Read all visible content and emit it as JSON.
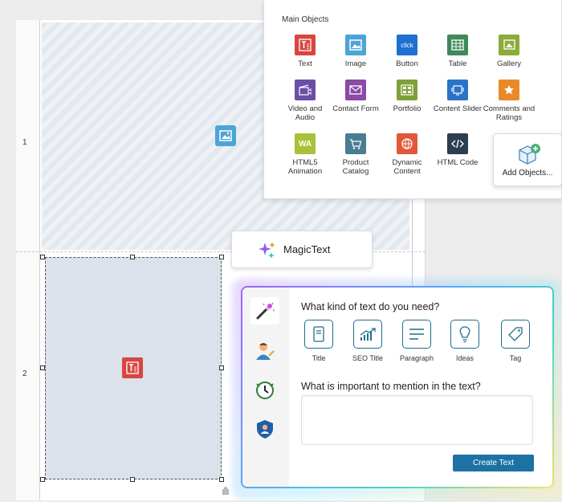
{
  "rows": {
    "row1": "1",
    "row2": "2"
  },
  "objects_panel": {
    "title": "Main Objects",
    "items": [
      {
        "label": "Text",
        "icon": "text-icon",
        "color": "#d9453f"
      },
      {
        "label": "Image",
        "icon": "image-icon",
        "color": "#4ba5d6"
      },
      {
        "label": "Button",
        "icon": "button-icon",
        "color": "#1f6fd1"
      },
      {
        "label": "Table",
        "icon": "table-icon",
        "color": "#3f8a5a"
      },
      {
        "label": "Gallery",
        "icon": "gallery-icon",
        "color": "#8bab3a"
      },
      {
        "label": "Video and Audio",
        "icon": "video-audio-icon",
        "color": "#6b4fa6"
      },
      {
        "label": "Contact Form",
        "icon": "contact-form-icon",
        "color": "#8a4aa5"
      },
      {
        "label": "Portfolio",
        "icon": "portfolio-icon",
        "color": "#7ea03a"
      },
      {
        "label": "Content Slider",
        "icon": "content-slider-icon",
        "color": "#2a73c9"
      },
      {
        "label": "Comments and Ratings",
        "icon": "comments-ratings-icon",
        "color": "#e98a27"
      },
      {
        "label": "HTML5 Animation",
        "icon": "html5-animation-icon",
        "color": "#a7c23a"
      },
      {
        "label": "Product Catalog",
        "icon": "product-catalog-icon",
        "color": "#4a7c92"
      },
      {
        "label": "Dynamic Content",
        "icon": "dynamic-content-icon",
        "color": "#e2583a"
      },
      {
        "label": "HTML Code",
        "icon": "html-code-icon",
        "color": "#2c3e50"
      }
    ],
    "button_glyph": "click",
    "add_objects_label": "Add Objects..."
  },
  "magic_text_button": {
    "label": "MagicText"
  },
  "magic_dialog": {
    "question_kind": "What kind of text do you need?",
    "options": [
      {
        "label": "Title",
        "icon": "title-icon"
      },
      {
        "label": "SEO Title",
        "icon": "seo-chart-icon"
      },
      {
        "label": "Paragraph",
        "icon": "paragraph-icon"
      },
      {
        "label": "Ideas",
        "icon": "lightbulb-icon"
      },
      {
        "label": "Tag",
        "icon": "tag-icon"
      }
    ],
    "question_important": "What is important to mention in the text?",
    "textarea_value": "",
    "create_label": "Create Text",
    "accent": "#1b72a3"
  }
}
